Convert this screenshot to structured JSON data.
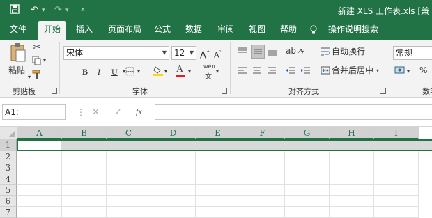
{
  "title": "新建 XLS 工作表.xls  [兼",
  "tabs": [
    "文件",
    "开始",
    "插入",
    "页面布局",
    "公式",
    "数据",
    "审阅",
    "视图",
    "帮助",
    "操作说明搜索"
  ],
  "clipboard": {
    "paste": "粘贴",
    "group": "剪贴板"
  },
  "font": {
    "name": "宋体",
    "size": "12",
    "bold": "B",
    "italic": "I",
    "underline": "U",
    "grow": "A",
    "shrink": "A",
    "color_a": "A",
    "phonetic": "wén",
    "group": "字体"
  },
  "alignment": {
    "wrap": "自动换行",
    "merge": "合并后居中",
    "group": "对齐方式"
  },
  "number": {
    "format": "常规",
    "percent": "%",
    "group": "数字"
  },
  "formula": {
    "namebox": "A1:",
    "cancel": "✕",
    "enter": "✓",
    "fx": "fx",
    "content": ""
  },
  "columns": [
    "A",
    "B",
    "C",
    "D",
    "E",
    "F",
    "G",
    "H",
    "I"
  ],
  "rows": [
    "1",
    "2",
    "3",
    "4",
    "5",
    "6",
    "7"
  ],
  "colors": {
    "accent": "#217346",
    "ribbon": "#f3f3f3",
    "font_color": "#e02020",
    "fill_color": "#ffd800"
  }
}
